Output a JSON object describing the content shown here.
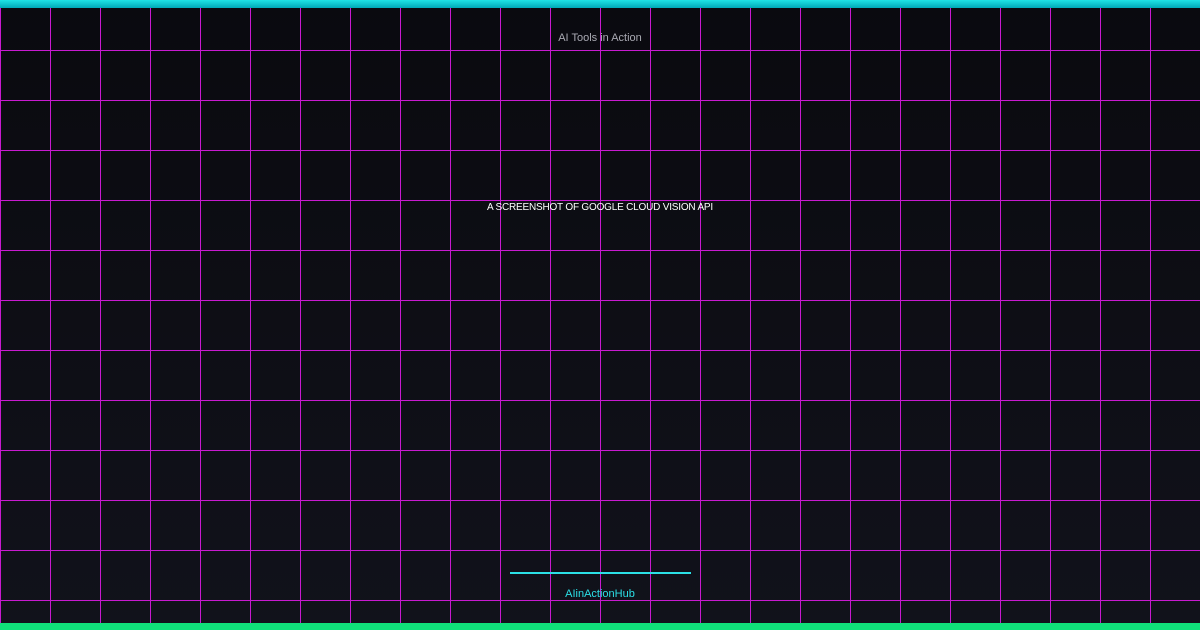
{
  "kicker": "AI Tools in Action",
  "headline": "A SCREENSHOT OF GOOGLE CLOUD VISION API",
  "brand": "AIinActionHub",
  "colors": {
    "grid_line": "#c81ad0",
    "top_bar": "#1fe3e6",
    "bottom_bar": "#10e07a",
    "accent": "#2be0e6",
    "background": "#0b0b10"
  }
}
